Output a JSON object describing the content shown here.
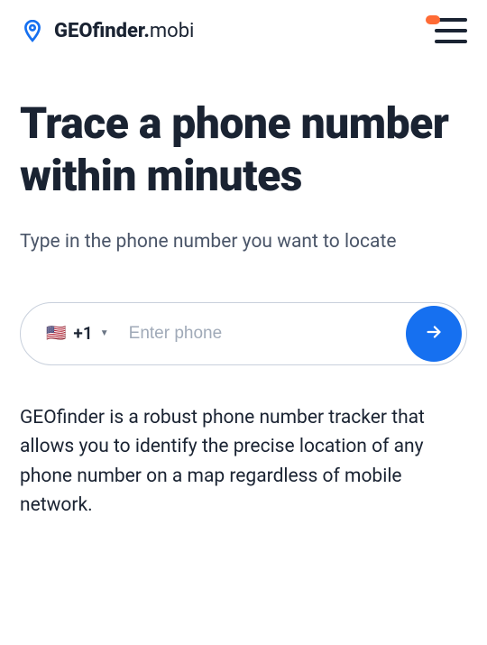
{
  "header": {
    "logo_bold": "GEOfinder.",
    "logo_light": "mobi"
  },
  "hero": {
    "title": "Trace a phone number within minutes",
    "subtitle": "Type in the phone number you want to locate"
  },
  "phone_form": {
    "flag": "🇺🇸",
    "country_code": "+1",
    "placeholder": "Enter phone"
  },
  "description": "GEOfinder is a robust phone number tracker that allows you to identify the precise location of any phone number on a map regardless of mobile network.",
  "colors": {
    "primary_blue": "#1670f0",
    "accent_orange": "#ff6b35",
    "text_dark": "#1a2332"
  }
}
